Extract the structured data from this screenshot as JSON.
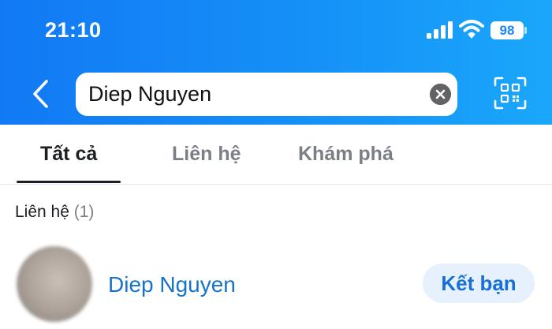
{
  "status_bar": {
    "time": "21:10",
    "battery": "98"
  },
  "search": {
    "value": "Diep Nguyen",
    "placeholder": ""
  },
  "tabs": [
    {
      "label": "Tất cả",
      "active": true
    },
    {
      "label": "Liên hệ",
      "active": false
    },
    {
      "label": "Khám phá",
      "active": false
    }
  ],
  "results": {
    "section_title": "Liên hệ",
    "section_count": "(1)",
    "contacts": [
      {
        "name": "Diep Nguyen",
        "action_label": "Kết bạn"
      }
    ]
  },
  "colors": {
    "header_blue": "#1590f7",
    "link_blue": "#1673c9",
    "button_bg": "#e6f1fd"
  },
  "icons": {
    "back": "chevron-left-icon",
    "clear": "clear-x-icon",
    "qr": "qr-scan-icon",
    "signal": "cellular-signal-icon",
    "wifi": "wifi-icon"
  }
}
